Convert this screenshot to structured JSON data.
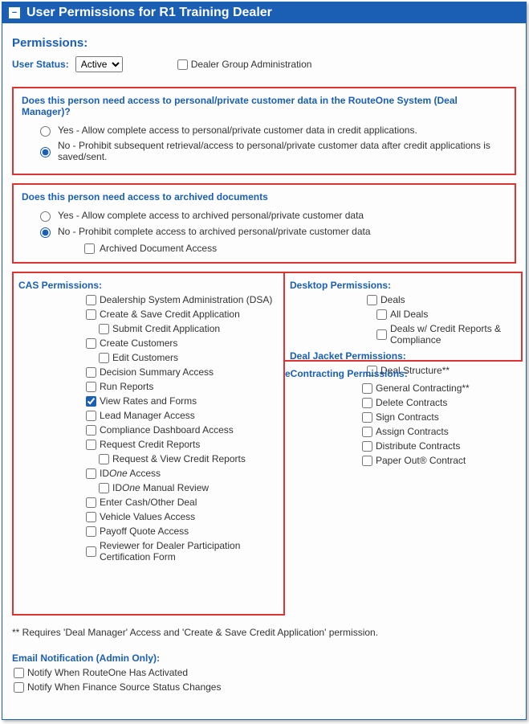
{
  "header": {
    "title": "User Permissions for R1 Training Dealer"
  },
  "permissions_label": "Permissions:",
  "user_status": {
    "label": "User Status:",
    "value": "Active"
  },
  "dealer_group_admin": {
    "label": "Dealer Group Administration",
    "checked": false
  },
  "q1": {
    "question": "Does this person need access to personal/private customer data in the RouteOne System (Deal Manager)?",
    "yes": "Yes - Allow complete access to personal/private customer data in credit applications.",
    "no": "No - Prohibit subsequent retrieval/access to personal/private customer data after credit applications is saved/sent.",
    "selected": "no"
  },
  "q2": {
    "question": "Does this person need access to archived documents",
    "yes": "Yes - Allow complete access to archived personal/private customer data",
    "no": "No - Prohibit complete access to archived personal/private customer data",
    "selected": "no",
    "archived_label": "Archived Document Access",
    "archived_checked": false
  },
  "cas": {
    "title": "CAS Permissions:",
    "items": [
      {
        "label": "Dealership System Administration (DSA)",
        "checked": false,
        "indent": 1
      },
      {
        "label": "Create & Save Credit Application",
        "checked": false,
        "indent": 1
      },
      {
        "label": "Submit Credit Application",
        "checked": false,
        "indent": 2
      },
      {
        "label": "Create Customers",
        "checked": false,
        "indent": 1
      },
      {
        "label": "Edit Customers",
        "checked": false,
        "indent": 2
      },
      {
        "label": "Decision Summary Access",
        "checked": false,
        "indent": 1
      },
      {
        "label": "Run Reports",
        "checked": false,
        "indent": 1
      },
      {
        "label": "View Rates and Forms",
        "checked": true,
        "indent": 1
      },
      {
        "label": "Lead Manager Access",
        "checked": false,
        "indent": 1
      },
      {
        "label": "Compliance Dashboard Access",
        "checked": false,
        "indent": 1
      },
      {
        "label": "Request Credit Reports",
        "checked": false,
        "indent": 1
      },
      {
        "label": "Request & View Credit Reports",
        "checked": false,
        "indent": 2
      },
      {
        "label_html": "ID<span class='idone-italic'>One</span> Access",
        "label": "IDOne Access",
        "checked": false,
        "indent": 1
      },
      {
        "label_html": "ID<span class='idone-italic'>One</span> Manual Review",
        "label": "IDOne Manual Review",
        "checked": false,
        "indent": 2
      },
      {
        "label": "Enter Cash/Other Deal",
        "checked": false,
        "indent": 1
      },
      {
        "label": "Vehicle Values Access",
        "checked": false,
        "indent": 1
      },
      {
        "label": "Payoff Quote Access",
        "checked": false,
        "indent": 1
      },
      {
        "label": "Reviewer for Dealer Participation Certification Form",
        "checked": false,
        "indent": 1
      }
    ]
  },
  "desktop": {
    "title": "Desktop Permissions:",
    "items": [
      {
        "label": "Deals",
        "checked": false,
        "indent": 1
      },
      {
        "label": "All Deals",
        "checked": false,
        "indent": 2
      },
      {
        "label": "Deals w/ Credit Reports & Compliance",
        "checked": false,
        "indent": 2
      }
    ]
  },
  "dealjacket": {
    "title": "Deal Jacket Permissions:",
    "items": [
      {
        "label": "Deal Structure**",
        "checked": false,
        "indent": 1
      }
    ]
  },
  "econtracting": {
    "title": "eContracting Permissions:",
    "items": [
      {
        "label": "General Contracting**",
        "checked": false
      },
      {
        "label": "Delete Contracts",
        "checked": false
      },
      {
        "label": "Sign Contracts",
        "checked": false
      },
      {
        "label": "Assign Contracts",
        "checked": false
      },
      {
        "label": "Distribute Contracts",
        "checked": false
      },
      {
        "label": "Paper Out® Contract",
        "checked": false
      }
    ]
  },
  "footnote": "** Requires 'Deal Manager' Access and 'Create & Save Credit Application' permission.",
  "email": {
    "title": "Email Notification (Admin Only):",
    "items": [
      {
        "label": "Notify When RouteOne Has Activated",
        "checked": false
      },
      {
        "label": "Notify When Finance Source Status Changes",
        "checked": false
      }
    ]
  }
}
